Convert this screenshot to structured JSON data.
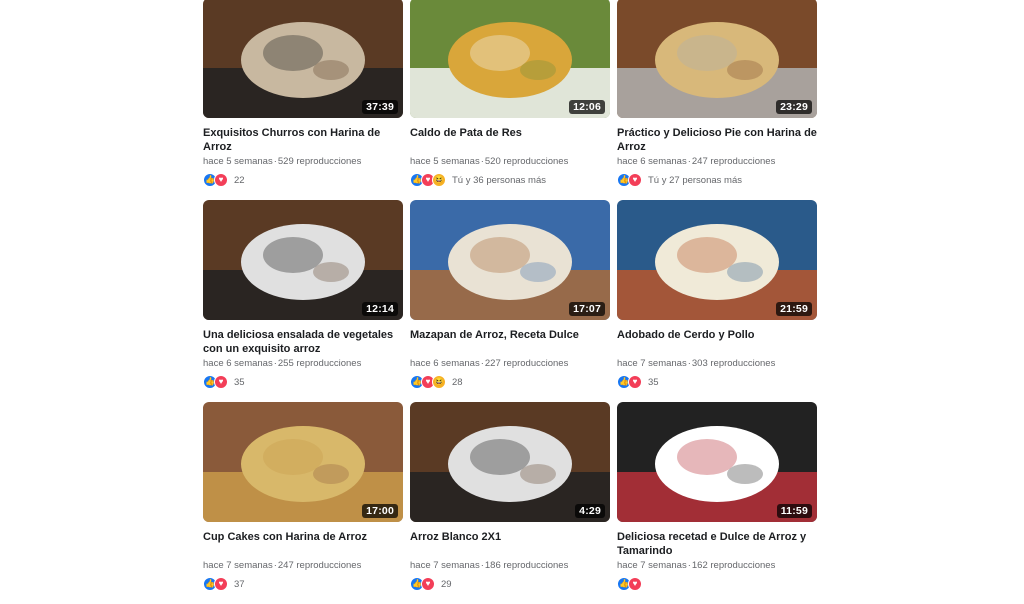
{
  "videos": [
    {
      "title": "Exquisitos Churros con Harina de Arroz",
      "duration": "37:39",
      "age": "hace 5 semanas",
      "views": "529 reproducciones",
      "reactions": [
        "like",
        "love"
      ],
      "reaction_count": "22",
      "colors": [
        "#5a3a24",
        "#c8b8a0",
        "#222222"
      ]
    },
    {
      "title": "Caldo de Pata de Res",
      "duration": "12:06",
      "age": "hace 5 semanas",
      "views": "520 reproducciones",
      "reactions": [
        "like",
        "love",
        "haha"
      ],
      "reaction_count": "Tú y 36 personas más",
      "colors": [
        "#6a8a3a",
        "#d9a63a",
        "#f4f4f4"
      ]
    },
    {
      "title": "Práctico y Delicioso Pie con Harina de Arroz",
      "duration": "23:29",
      "age": "hace 6 semanas",
      "views": "247 reproducciones",
      "reactions": [
        "like",
        "love"
      ],
      "reaction_count": "Tú y 27 personas más",
      "colors": [
        "#7a4a2a",
        "#d8b87a",
        "#b0b0b0"
      ]
    },
    {
      "title": "Una deliciosa ensalada de vegetales con un exquisito arroz",
      "duration": "12:14",
      "age": "hace 6 semanas",
      "views": "255 reproducciones",
      "reactions": [
        "like",
        "love"
      ],
      "reaction_count": "35",
      "colors": [
        "#5a3a24",
        "#e0e0e0",
        "#222222"
      ]
    },
    {
      "title": "Mazapan de Arroz, Receta Dulce",
      "duration": "17:07",
      "age": "hace 6 semanas",
      "views": "227 reproducciones",
      "reactions": [
        "like",
        "love",
        "haha"
      ],
      "reaction_count": "28",
      "colors": [
        "#3a6aa8",
        "#e9e2d4",
        "#a86a3a"
      ]
    },
    {
      "title": "Adobado de Cerdo y Pollo",
      "duration": "21:59",
      "age": "hace 7 semanas",
      "views": "303 reproducciones",
      "reactions": [
        "like",
        "love"
      ],
      "reaction_count": "35",
      "colors": [
        "#2a5a8a",
        "#f0ead8",
        "#b8562a"
      ]
    },
    {
      "title": "Cup Cakes con Harina de Arroz",
      "duration": "17:00",
      "age": "hace 7 semanas",
      "views": "247 reproducciones",
      "reactions": [
        "like",
        "love"
      ],
      "reaction_count": "37",
      "colors": [
        "#8a5a3a",
        "#d8b86a",
        "#c89a4a"
      ]
    },
    {
      "title": "Arroz Blanco 2X1",
      "duration": "4:29",
      "age": "hace 7 semanas",
      "views": "186 reproducciones",
      "reactions": [
        "like",
        "love"
      ],
      "reaction_count": "29",
      "colors": [
        "#5a3a24",
        "#e0e0e0",
        "#222222"
      ]
    },
    {
      "title": "Deliciosa recetad e Dulce de Arroz y Tamarindo",
      "duration": "11:59",
      "age": "hace 7 semanas",
      "views": "162 reproducciones",
      "reactions": [
        "like",
        "love"
      ],
      "reaction_count": "",
      "colors": [
        "#222222",
        "#ffffff",
        "#b8303a"
      ]
    }
  ]
}
